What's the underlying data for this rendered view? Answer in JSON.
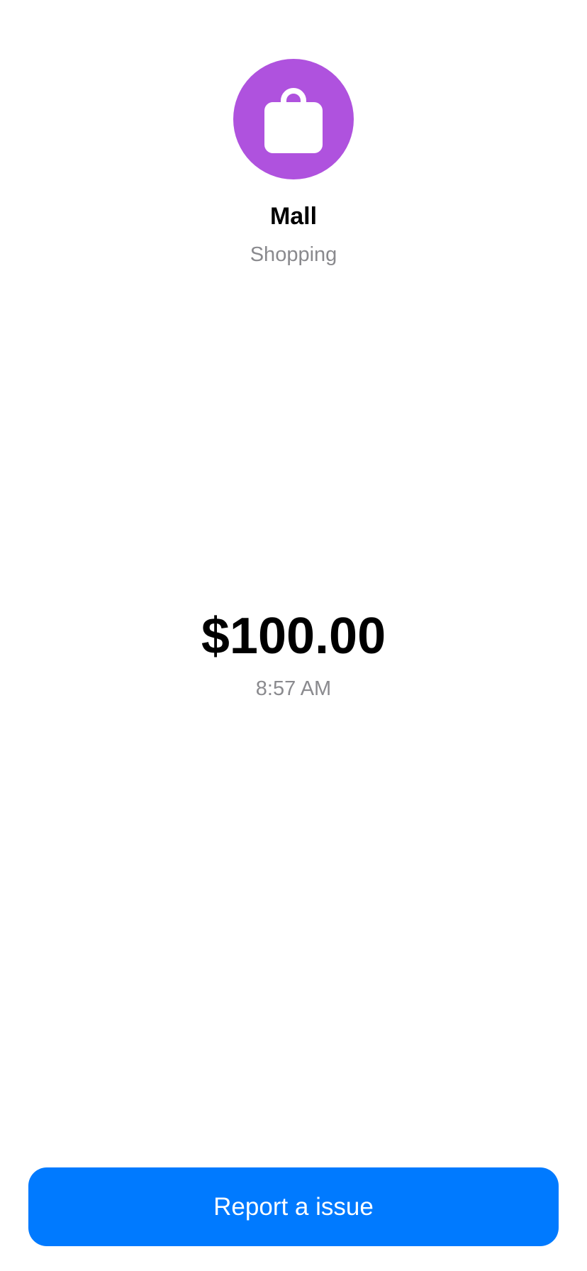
{
  "merchant": {
    "icon": "shopping-bag-icon",
    "icon_color": "#af52de",
    "name": "Mall",
    "category": "Shopping"
  },
  "transaction": {
    "amount": "$100.00",
    "time": "8:57 AM"
  },
  "actions": {
    "report_label": "Report a issue",
    "report_color": "#007aff"
  }
}
